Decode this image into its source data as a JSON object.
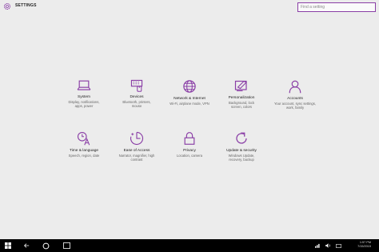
{
  "header": {
    "title": "SETTINGS",
    "search_placeholder": "Find a setting"
  },
  "tiles": [
    {
      "title": "System",
      "desc": "Display, notifications, apps, power",
      "icon": "laptop-icon"
    },
    {
      "title": "Devices",
      "desc": "Bluetooth, printers, mouse",
      "icon": "keyboard-devices-icon"
    },
    {
      "title": "Network & Internet",
      "desc": "Wi-Fi, airplane mode, VPN",
      "icon": "globe-icon"
    },
    {
      "title": "Personalization",
      "desc": "Background, lock screen, colors",
      "icon": "paint-icon"
    },
    {
      "title": "Accounts",
      "desc": "Your account, sync settings, work, family",
      "icon": "person-icon"
    },
    {
      "title": "Time & language",
      "desc": "Speech, region, date",
      "icon": "time-language-icon"
    },
    {
      "title": "Ease of Access",
      "desc": "Narrator, magnifier, high contrast",
      "icon": "ease-of-access-icon"
    },
    {
      "title": "Privacy",
      "desc": "Location, camera",
      "icon": "lock-icon"
    },
    {
      "title": "Update & security",
      "desc": "Windows Update, recovery, backup",
      "icon": "refresh-icon"
    }
  ],
  "taskbar": {
    "time": "1:57 PM",
    "date": "7/15/2015"
  },
  "colors": {
    "accent": "#8a3ea6",
    "background": "#ececec",
    "taskbar": "#000000"
  }
}
